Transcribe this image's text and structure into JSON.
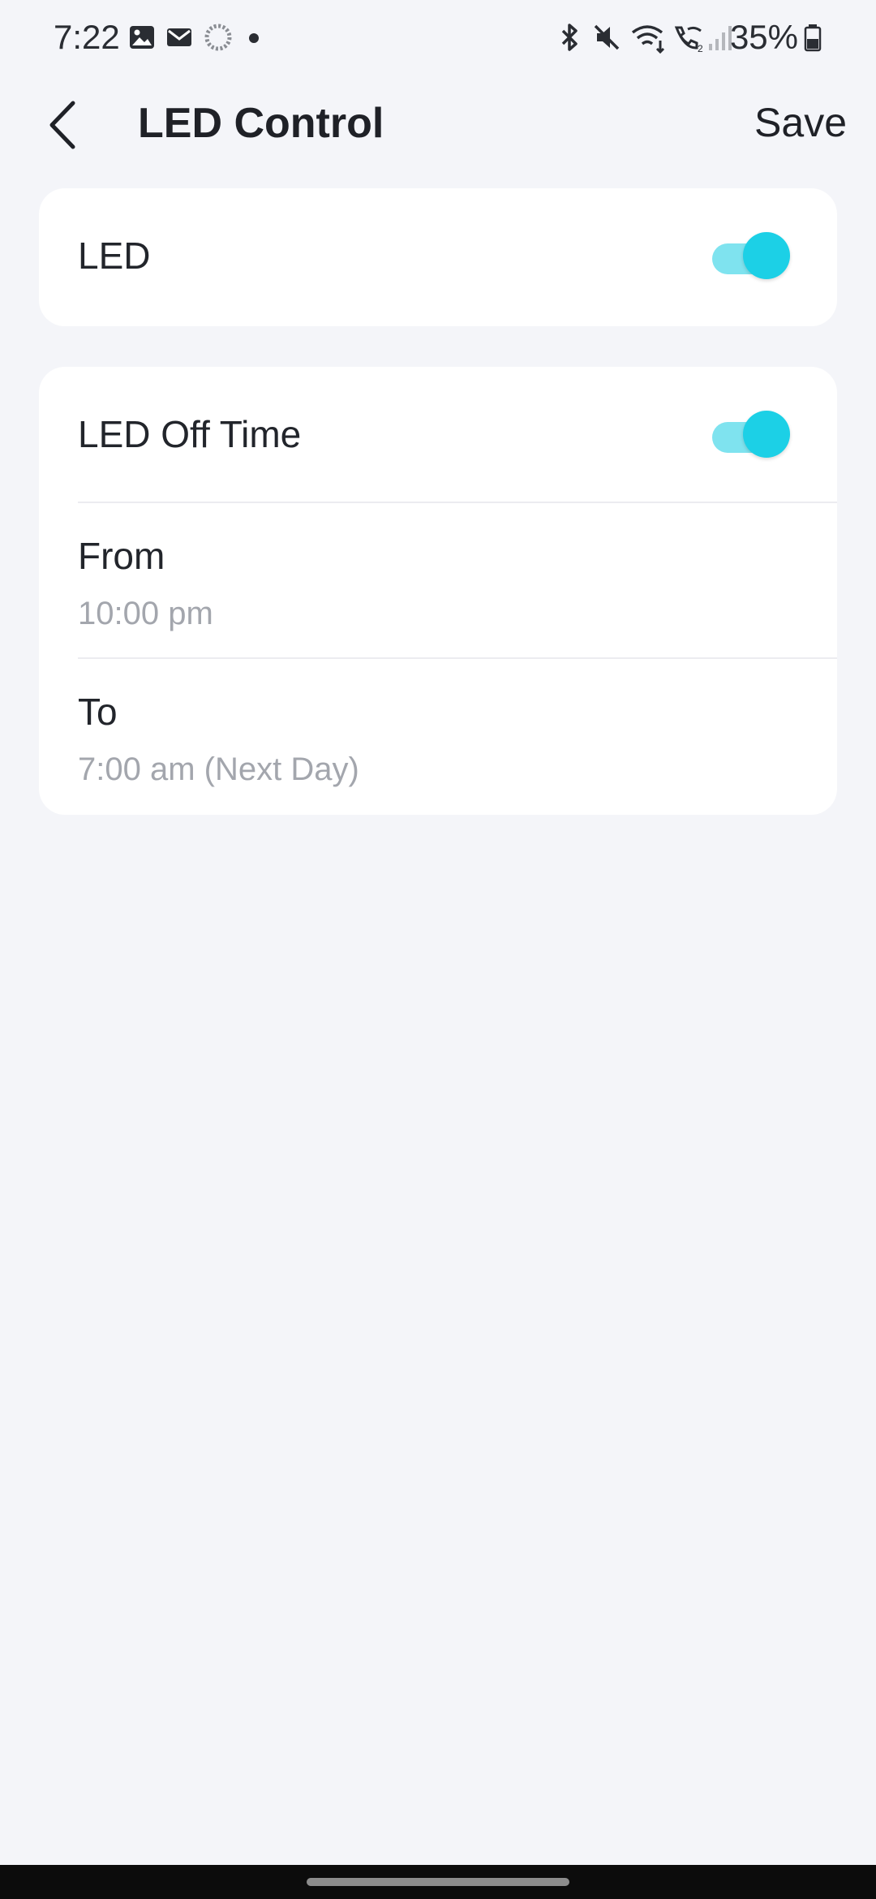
{
  "status_bar": {
    "time": "7:22",
    "battery_percent": "35%",
    "icons_left": [
      "gallery-icon",
      "mail-icon",
      "sync-icon",
      "dot-icon"
    ],
    "icons_right": [
      "bluetooth-icon",
      "mute-icon",
      "wifi-icon",
      "wifi-call-icon",
      "signal-icon",
      "battery-icon"
    ]
  },
  "header": {
    "title": "LED Control",
    "save_label": "Save",
    "back_icon": "chevron-left-icon"
  },
  "led_card": {
    "label": "LED",
    "toggle_on": true
  },
  "off_time_card": {
    "label": "LED Off Time",
    "toggle_on": true,
    "from": {
      "label": "From",
      "value": "10:00 pm"
    },
    "to": {
      "label": "To",
      "value": "7:00 am (Next Day)"
    }
  },
  "colors": {
    "background": "#f4f5f9",
    "card": "#ffffff",
    "toggle_active": "#1cd0e6",
    "toggle_track": "#7fe3ef",
    "secondary_text": "#a3a6ad"
  }
}
